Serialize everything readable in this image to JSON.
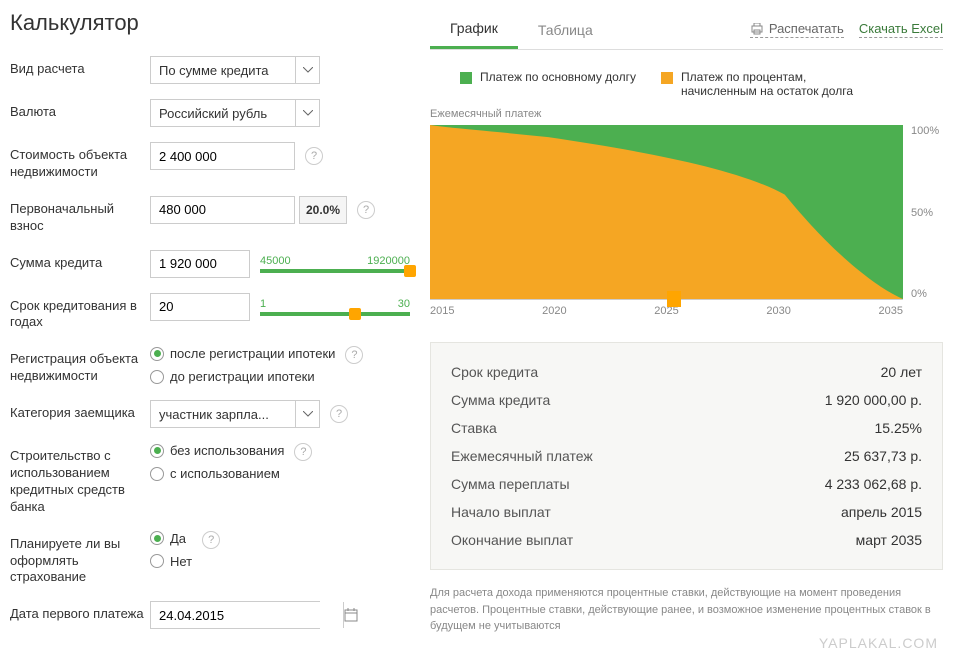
{
  "title": "Калькулятор",
  "form": {
    "calc_type": {
      "label": "Вид расчета",
      "value": "По сумме кредита"
    },
    "currency": {
      "label": "Валюта",
      "value": "Российский рубль"
    },
    "property_cost": {
      "label": "Стоимость объекта недвижимости",
      "value": "2 400 000"
    },
    "down_payment": {
      "label": "Первоначальный взнос",
      "value": "480 000",
      "pct": "20.0%"
    },
    "loan_amount": {
      "label": "Сумма кредита",
      "value": "1 920 000",
      "min": "45000",
      "max": "1920000"
    },
    "term_years": {
      "label": "Срок кредитования в годах",
      "value": "20",
      "min": "1",
      "max": "30"
    },
    "registration": {
      "label": "Регистрация объекта недвижимости",
      "opt1": "после регистрации ипотеки",
      "opt2": "до регистрации ипотеки"
    },
    "borrower_cat": {
      "label": "Категория заемщика",
      "value": "участник зарпла..."
    },
    "construction": {
      "label": "Строительство с использованием кредитных средств банка",
      "opt1": "без использования",
      "opt2": "с использованием"
    },
    "insurance": {
      "label": "Планируете ли вы оформлять страхование",
      "yes": "Да",
      "no": "Нет"
    },
    "first_payment_date": {
      "label": "Дата первого платежа",
      "value": "24.04.2015"
    }
  },
  "tabs": {
    "chart": "График",
    "table": "Таблица"
  },
  "actions": {
    "print": "Распечатать",
    "excel": "Скачать Excel"
  },
  "legend": {
    "principal": "Платеж по основному долгу",
    "interest": "Платеж по процентам, начисленным на остаток долга"
  },
  "chart_data": {
    "type": "area",
    "title": "Ежемесячный платеж",
    "xlabel": "",
    "ylabel": "",
    "ylim": [
      0,
      100
    ],
    "x": [
      2015,
      2020,
      2025,
      2030,
      2035
    ],
    "y_ticks": [
      "100%",
      "50%",
      "0%"
    ],
    "series": [
      {
        "name": "Платеж по процентам, начисленным на остаток долга",
        "color": "#f5a623",
        "values": [
          100,
          95,
          83,
          60,
          0
        ]
      },
      {
        "name": "Платеж по основному долгу",
        "color": "#4caf50",
        "values": [
          0,
          5,
          17,
          40,
          100
        ]
      }
    ],
    "marker_x": 2025
  },
  "summary": {
    "term": {
      "label": "Срок кредита",
      "value": "20 лет"
    },
    "amount": {
      "label": "Сумма кредита",
      "value": "1 920 000,00 р."
    },
    "rate": {
      "label": "Ставка",
      "value": "15.25%"
    },
    "monthly": {
      "label": "Ежемесячный платеж",
      "value": "25 637,73 р."
    },
    "overpay": {
      "label": "Сумма переплаты",
      "value": "4 233 062,68 р."
    },
    "start": {
      "label": "Начало выплат",
      "value": "апрель 2015"
    },
    "end": {
      "label": "Окончание выплат",
      "value": "март 2035"
    }
  },
  "disclaimer": "Для расчета дохода применяются процентные ставки, действующие на момент проведения расчетов. Процентные ставки, действующие ранее, и возможное изменение процентных ставок в будущем не учитываются",
  "watermark": "YAPLAKAL.COM"
}
